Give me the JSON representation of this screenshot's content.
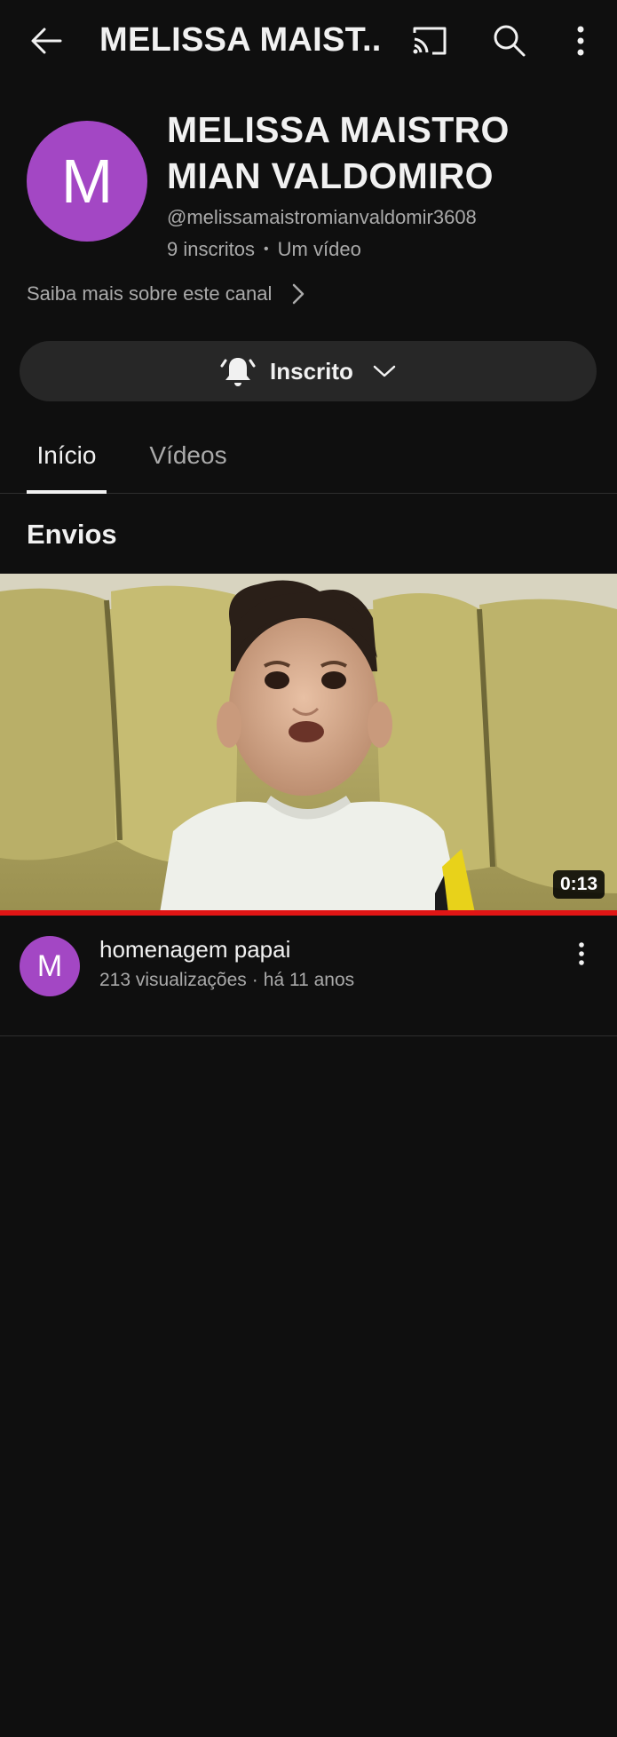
{
  "header": {
    "title": "MELISSA MAIST...",
    "back_icon": "arrow-left-icon",
    "cast_icon": "cast-icon",
    "search_icon": "search-icon",
    "more_icon": "more-vert-icon"
  },
  "channel": {
    "avatar_letter": "M",
    "avatar_color": "#a347c4",
    "name_line1": "MELISSA MAISTRO",
    "name_line2": "MIAN VALDOMIRO",
    "handle": "@melissamaistromianvaldomir3608",
    "subscribers": "9 inscritos",
    "stats_separator": "•",
    "video_count": "Um vídeo",
    "about_label": "Saiba mais sobre este canal"
  },
  "subscribe": {
    "label": "Inscrito",
    "bell_icon": "bell-icon",
    "chevron_icon": "chevron-down-icon"
  },
  "tabs": [
    {
      "label": "Início",
      "active": true
    },
    {
      "label": "Vídeos",
      "active": false
    }
  ],
  "section": {
    "title": "Envios"
  },
  "video": {
    "duration": "0:13",
    "progress_fraction": 1.0,
    "progress_color": "#e01515",
    "avatar_letter": "M",
    "title": "homenagem papai",
    "views": "213 visualizações",
    "meta_separator": "·",
    "age": "há 11 anos"
  }
}
